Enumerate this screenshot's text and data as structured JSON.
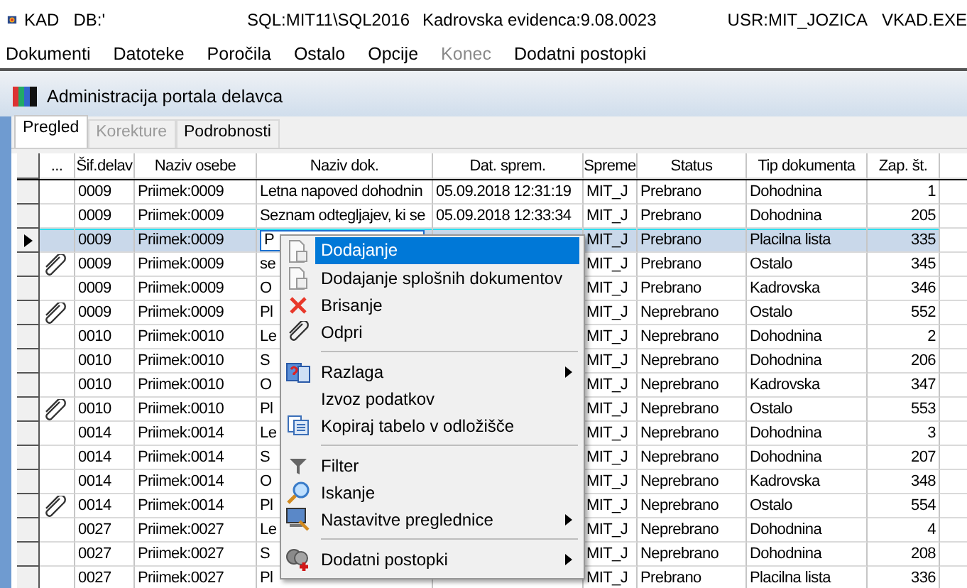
{
  "app_title": {
    "items": [
      "KAD",
      "DB:'",
      "SQL:MIT11\\SQL2016",
      "Kadrovska evidenca:9.08.0023",
      "USR:MIT_JOZICA",
      "VKAD.EXE"
    ]
  },
  "menu_bar": [
    {
      "label": "Dokumenti",
      "disabled": false
    },
    {
      "label": "Datoteke",
      "disabled": false
    },
    {
      "label": "Poročila",
      "disabled": false
    },
    {
      "label": "Ostalo",
      "disabled": false
    },
    {
      "label": "Opcije",
      "disabled": false
    },
    {
      "label": "Konec",
      "disabled": true
    },
    {
      "label": "Dodatni postopki",
      "disabled": false
    }
  ],
  "window": {
    "title": "Administracija portala delavca"
  },
  "tabs": [
    {
      "label": "Pregled",
      "selected": true,
      "disabled": false
    },
    {
      "label": "Korekture",
      "selected": false,
      "disabled": true
    },
    {
      "label": "Podrobnosti",
      "selected": false,
      "disabled": false
    }
  ],
  "table": {
    "columns": [
      "...",
      "Šif.delav",
      "Naziv osebe",
      "Naziv dok.",
      "Dat. sprem.",
      "Spreme",
      "Status",
      "Tip dokumenta",
      "Zap. št."
    ],
    "rows": [
      {
        "selected": false,
        "attachment": false,
        "sif": "0009",
        "oseba": "Priimek:0009",
        "dok": "Letna napoved dohodnin",
        "dat": "05.09.2018 12:31:19",
        "spreme": "MIT_J",
        "status": "Prebrano",
        "tip": "Dohodnina",
        "zap": "1"
      },
      {
        "selected": false,
        "attachment": false,
        "sif": "0009",
        "oseba": "Priimek:0009",
        "dok": "Seznam odtegljajev, ki se",
        "dat": "05.09.2018 12:33:34",
        "spreme": "MIT_J",
        "status": "Prebrano",
        "tip": "Dohodnina",
        "zap": "205"
      },
      {
        "selected": true,
        "attachment": false,
        "sif": "0009",
        "oseba": "Priimek:0009",
        "dok": "P",
        "spreme": "MIT_J",
        "status": "Prebrano",
        "tip": "Placilna lista",
        "zap": "335"
      },
      {
        "selected": false,
        "attachment": true,
        "sif": "0009",
        "oseba": "Priimek:0009",
        "dok": "se",
        "spreme": "MIT_J",
        "status": "Prebrano",
        "tip": "Ostalo",
        "zap": "345"
      },
      {
        "selected": false,
        "attachment": false,
        "sif": "0009",
        "oseba": "Priimek:0009",
        "dok": "O",
        "spreme": "MIT_J",
        "status": "Prebrano",
        "tip": "Kadrovska",
        "zap": "346"
      },
      {
        "selected": false,
        "attachment": true,
        "sif": "0009",
        "oseba": "Priimek:0009",
        "dok": "Pl",
        "spreme": "MIT_J",
        "status": "Neprebrano",
        "tip": "Ostalo",
        "zap": "552"
      },
      {
        "selected": false,
        "attachment": false,
        "sif": "0010",
        "oseba": "Priimek:0010",
        "dok": "Le",
        "spreme": "MIT_J",
        "status": "Neprebrano",
        "tip": "Dohodnina",
        "zap": "2"
      },
      {
        "selected": false,
        "attachment": false,
        "sif": "0010",
        "oseba": "Priimek:0010",
        "dok": "S",
        "spreme": "MIT_J",
        "status": "Neprebrano",
        "tip": "Dohodnina",
        "zap": "206"
      },
      {
        "selected": false,
        "attachment": false,
        "sif": "0010",
        "oseba": "Priimek:0010",
        "dok": "O",
        "spreme": "MIT_J",
        "status": "Neprebrano",
        "tip": "Kadrovska",
        "zap": "347"
      },
      {
        "selected": false,
        "attachment": true,
        "sif": "0010",
        "oseba": "Priimek:0010",
        "dok": "Pl",
        "spreme": "MIT_J",
        "status": "Neprebrano",
        "tip": "Ostalo",
        "zap": "553"
      },
      {
        "selected": false,
        "attachment": false,
        "sif": "0014",
        "oseba": "Priimek:0014",
        "dok": "Le",
        "spreme": "MIT_J",
        "status": "Neprebrano",
        "tip": "Dohodnina",
        "zap": "3"
      },
      {
        "selected": false,
        "attachment": false,
        "sif": "0014",
        "oseba": "Priimek:0014",
        "dok": "S",
        "spreme": "MIT_J",
        "status": "Neprebrano",
        "tip": "Dohodnina",
        "zap": "207"
      },
      {
        "selected": false,
        "attachment": false,
        "sif": "0014",
        "oseba": "Priimek:0014",
        "dok": "O",
        "spreme": "MIT_J",
        "status": "Neprebrano",
        "tip": "Kadrovska",
        "zap": "348"
      },
      {
        "selected": false,
        "attachment": true,
        "sif": "0014",
        "oseba": "Priimek:0014",
        "dok": "Pl",
        "spreme": "MIT_J",
        "status": "Neprebrano",
        "tip": "Ostalo",
        "zap": "554"
      },
      {
        "selected": false,
        "attachment": false,
        "sif": "0027",
        "oseba": "Priimek:0027",
        "dok": "Le",
        "spreme": "MIT_J",
        "status": "Neprebrano",
        "tip": "Dohodnina",
        "zap": "4"
      },
      {
        "selected": false,
        "attachment": false,
        "sif": "0027",
        "oseba": "Priimek:0027",
        "dok": "S",
        "spreme": "MIT_J",
        "status": "Neprebrano",
        "tip": "Dohodnina",
        "zap": "208"
      },
      {
        "selected": false,
        "attachment": false,
        "sif": "0027",
        "oseba": "Priimek:0027",
        "dok": "Pl",
        "spreme": "MIT_J",
        "status": "Prebrano",
        "tip": "Placilna lista",
        "zap": "336"
      }
    ]
  },
  "context_menu": {
    "items": [
      {
        "kind": "item",
        "label": "Dodajanje",
        "selected": true,
        "submenu": false
      },
      {
        "kind": "item",
        "label": "Dodajanje splošnih dokumentov",
        "selected": false,
        "submenu": false
      },
      {
        "kind": "item",
        "label": "Brisanje",
        "selected": false,
        "submenu": false
      },
      {
        "kind": "item",
        "label": "Odpri",
        "selected": false,
        "submenu": false
      },
      {
        "kind": "separator"
      },
      {
        "kind": "item",
        "label": "Razlaga",
        "selected": false,
        "submenu": true
      },
      {
        "kind": "item",
        "label": "Izvoz podatkov",
        "selected": false,
        "submenu": false
      },
      {
        "kind": "item",
        "label": "Kopiraj tabelo v odložišče",
        "selected": false,
        "submenu": false
      },
      {
        "kind": "separator"
      },
      {
        "kind": "item",
        "label": "Filter",
        "selected": false,
        "submenu": false
      },
      {
        "kind": "item",
        "label": "Iskanje",
        "selected": false,
        "submenu": false
      },
      {
        "kind": "item",
        "label": "Nastavitve preglednice",
        "selected": false,
        "submenu": true
      },
      {
        "kind": "separator"
      },
      {
        "kind": "item",
        "label": "Dodatni postopki",
        "selected": false,
        "submenu": true
      }
    ]
  }
}
